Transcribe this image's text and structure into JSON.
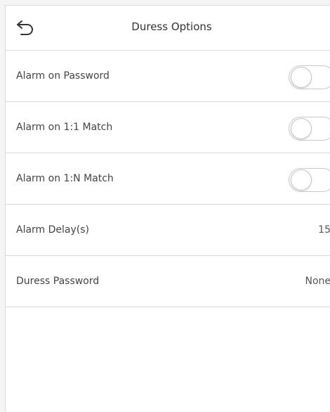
{
  "header": {
    "title": "Duress Options",
    "back_icon": "back-arrow-icon"
  },
  "settings": [
    {
      "label": "Alarm on Password",
      "control": "toggle",
      "state": "off"
    },
    {
      "label": "Alarm on 1:1 Match",
      "control": "toggle",
      "state": "off"
    },
    {
      "label": "Alarm on 1:N Match",
      "control": "toggle",
      "state": "off"
    },
    {
      "label": "Alarm Delay(s)",
      "control": "value",
      "value": "15"
    },
    {
      "label": "Duress Password",
      "control": "value",
      "value": "None"
    }
  ]
}
